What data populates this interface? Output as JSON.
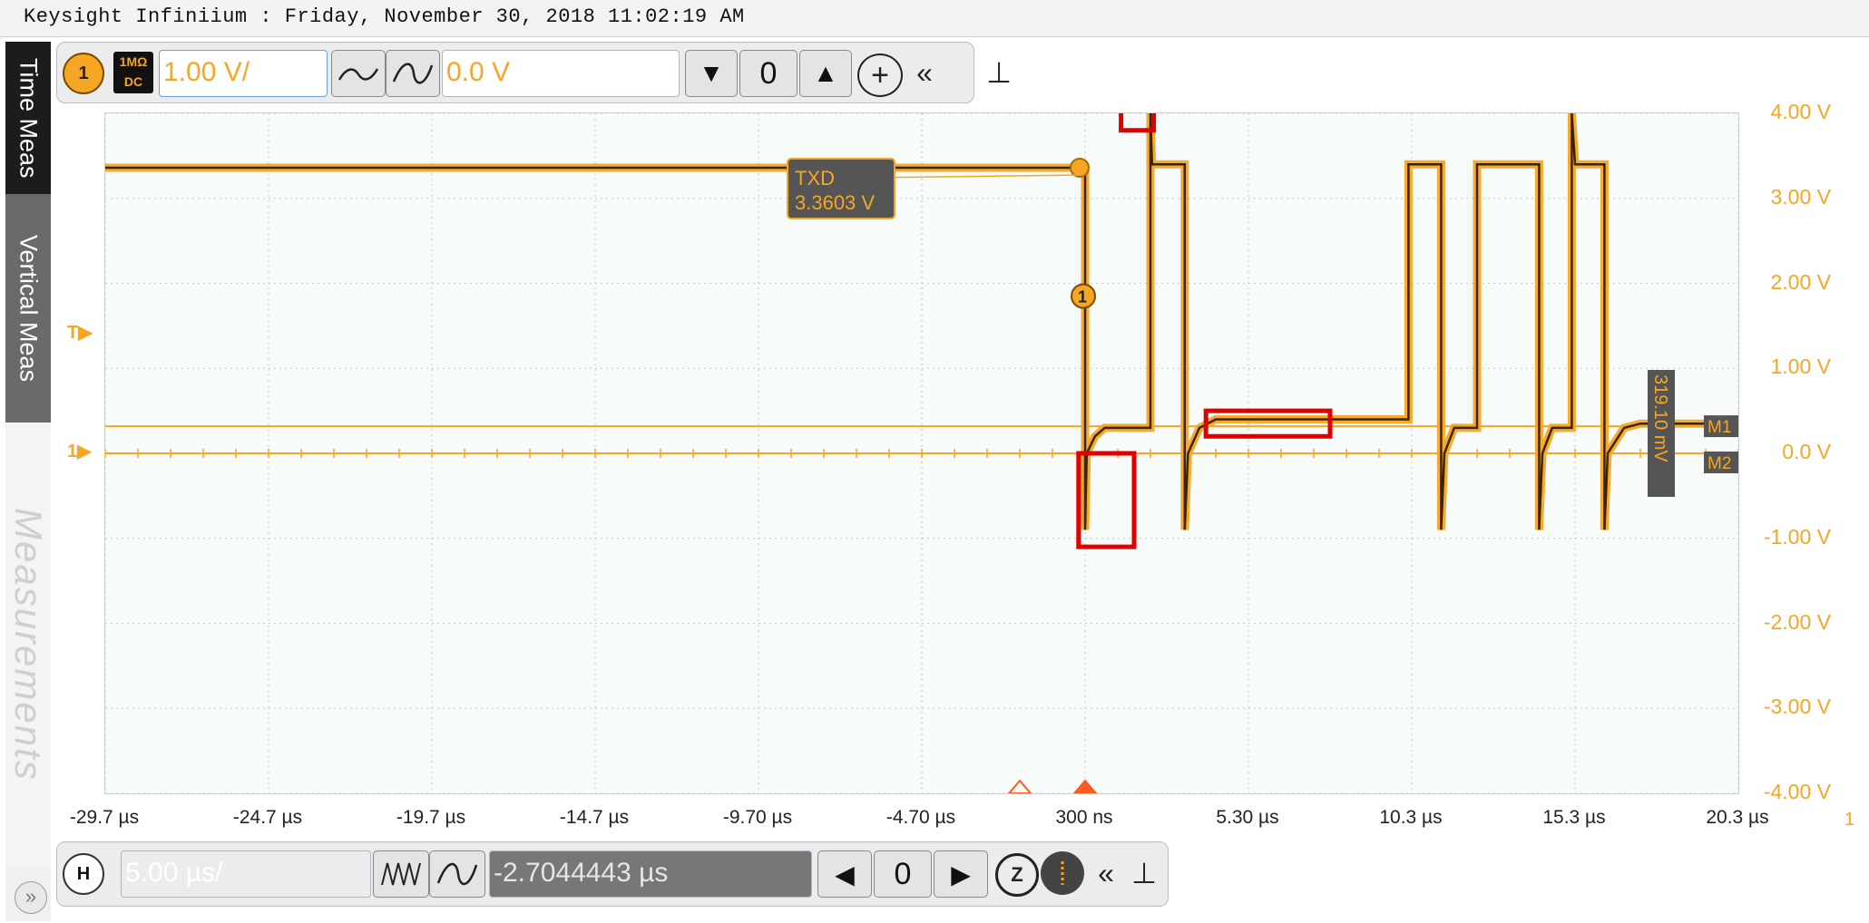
{
  "window": {
    "title": "Keysight Infiniium : Friday, November 30, 2018 11:02:19 AM"
  },
  "side_tabs": {
    "time_meas": "Time Meas",
    "vertical_meas": "Vertical Meas",
    "measurements": "Measurements",
    "expand_icon": "»"
  },
  "vertical_toolbar": {
    "channel_number": "1",
    "coupling_impedance": "1MΩ",
    "coupling_mode": "DC",
    "scale_value": "1.00 V/",
    "offset_value": "0.0 V",
    "icons": [
      "ac-coupling-icon",
      "dc-coupling-icon",
      "offset-down-icon",
      "offset-zero-icon",
      "offset-up-icon",
      "add-channel-icon",
      "collapse-icon",
      "pin-icon"
    ],
    "glyphs": {
      "down": "▼",
      "zero": "0",
      "up": "▲",
      "add": "+",
      "collapse": "«",
      "pin": "⊥"
    }
  },
  "horizontal_toolbar": {
    "label": "H",
    "time_scale_value": "5.00 µs/",
    "position_value": "-2.7044443 µs",
    "glyphs": {
      "left": "◀",
      "zero": "0",
      "right": "▶",
      "zoom": "Z",
      "collapse": "«",
      "pin": "⊥"
    }
  },
  "markers": {
    "trigger_level_label": "T",
    "ground_label": "1",
    "m1_label": "M1",
    "m2_label": "M2",
    "marker_delta_label": "319.10 mV",
    "callout_name": "TXD",
    "callout_value": "3.3603 V",
    "edge_marker": "1"
  },
  "chart_data": {
    "type": "line",
    "title": "",
    "xlabel": "",
    "ylabel": "",
    "xlim": [
      -29.7,
      20.3
    ],
    "ylim": [
      -4.0,
      4.0
    ],
    "x_unit": "µs",
    "x_tick_labels": [
      "-29.7 µs",
      "-24.7 µs",
      "-19.7 µs",
      "-14.7 µs",
      "-9.70 µs",
      "-4.70 µs",
      "300 ns",
      "5.30 µs",
      "10.3 µs",
      "15.3 µs",
      "20.3 µs"
    ],
    "y_tick_labels": [
      "4.00 V",
      "3.00 V",
      "2.00 V",
      "1.00 V",
      "0.0 V",
      "-1.00 V",
      "-2.00 V",
      "-3.00 V",
      "-4.00 V"
    ],
    "y_tick_values": [
      4,
      3,
      2,
      1,
      0,
      -1,
      -2,
      -3,
      -4
    ],
    "series": [
      {
        "x": [
          -29.7,
          0.3,
          0.3,
          0.35,
          0.6,
          0.9,
          2.3,
          2.3,
          2.35,
          3.35,
          3.35,
          3.45,
          3.8,
          4.3,
          10.2,
          10.2,
          10.3,
          11.2,
          11.2,
          11.3,
          11.6,
          12.3,
          12.3,
          12.4,
          14.2,
          14.2,
          14.3,
          14.6,
          15.2,
          15.2,
          15.3,
          16.2,
          16.2,
          16.3,
          16.8,
          17.3,
          20.3
        ],
        "y": [
          3.36,
          3.36,
          -0.9,
          0.0,
          0.2,
          0.3,
          0.3,
          4.0,
          3.4,
          3.4,
          -0.9,
          0.0,
          0.3,
          0.4,
          0.4,
          3.4,
          3.4,
          3.4,
          -0.9,
          0.0,
          0.3,
          0.3,
          3.4,
          3.4,
          3.4,
          -0.9,
          0.0,
          0.3,
          0.3,
          4.0,
          3.4,
          3.4,
          -0.9,
          0.0,
          0.3,
          0.35,
          0.35
        ]
      }
    ],
    "marker_m1_voltage": 0.319,
    "marker_m2_voltage": 0.0,
    "callout": {
      "name": "TXD",
      "value": "3.3603 V"
    },
    "highlight_boxes": [
      {
        "x_range": [
          0.1,
          1.8
        ],
        "y_range": [
          -1.1,
          0.0
        ]
      },
      {
        "x_range": [
          1.4,
          2.4
        ],
        "y_range": [
          3.8,
          4.2
        ]
      },
      {
        "x_range": [
          4.0,
          7.8
        ],
        "y_range": [
          0.2,
          0.5
        ]
      }
    ],
    "trace_color": "#f5a623",
    "highlight_color": "#e00000",
    "grid": true
  }
}
